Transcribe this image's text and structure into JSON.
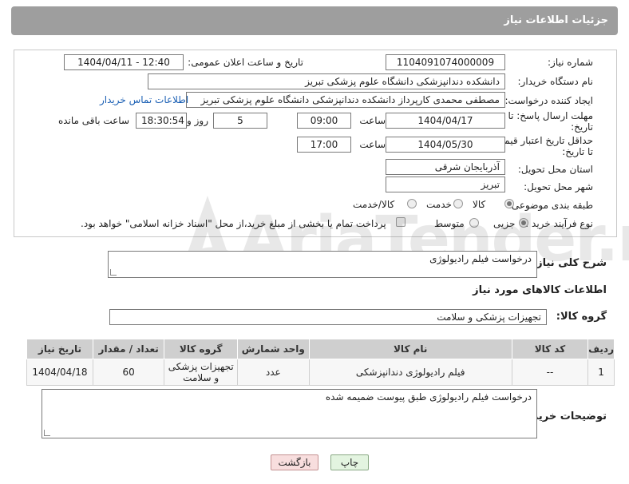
{
  "header": {
    "title": "جزئیات اطلاعات نیاز"
  },
  "form": {
    "need_number_label": "شماره نیاز:",
    "need_number": "1104091074000009",
    "announce_label": "تاریخ و ساعت اعلان عمومی:",
    "announce_value": "1404/04/11 - 12:40",
    "buyer_org_label": "نام دستگاه خریدار:",
    "buyer_org": "دانشکده دندانپزشکی دانشگاه علوم پزشکی تبریز",
    "creator_label": "ایجاد کننده درخواست:",
    "creator": "مصطفی محمدی کارپرداز دانشکده دندانپزشکی دانشگاه علوم پزشکی تبریز",
    "contact_link": "اطلاعات تماس خریدار",
    "deadline_label_1": "مهلت ارسال پاسخ: تا",
    "deadline_label_2": "تاریخ:",
    "deadline_date": "1404/04/17",
    "time_label": "ساعت",
    "deadline_time": "09:00",
    "days_value": "5",
    "days_label": "روز و",
    "remaining_time": "18:30:54",
    "remaining_label": "ساعت باقی مانده",
    "price_valid_label_1": "حداقل تاریخ اعتبار قیمت:",
    "price_valid_label_2": "تا تاریخ:",
    "price_valid_date": "1404/05/30",
    "price_valid_time": "17:00",
    "province_label": "استان محل تحویل:",
    "province": "آذربایجان شرقی",
    "city_label": "شهر محل تحویل:",
    "city": "تبریز",
    "category_label": "طبقه بندی موضوعی:",
    "category_options": [
      "کالا",
      "خدمت",
      "کالا/خدمت"
    ],
    "process_label": "نوع فرآیند خرید :",
    "process_options": [
      "جزیی",
      "متوسط"
    ],
    "payment_note": "پرداخت تمام یا بخشی از مبلغ خرید،از محل \"اسناد خزانه اسلامی\" خواهد بود."
  },
  "summary": {
    "label": "شرح کلی نیاز:",
    "value": "درخواست فیلم رادیولوژی"
  },
  "goods": {
    "section_title": "اطلاعات کالاهای مورد نیاز",
    "group_label": "گروه کالا:",
    "group_value": "تجهیزات پزشکی و سلامت"
  },
  "table": {
    "headers": [
      "ردیف",
      "کد کالا",
      "نام کالا",
      "واحد شمارش",
      "گروه کالا",
      "تعداد / مقدار",
      "تاریخ نیاز"
    ],
    "rows": [
      [
        "1",
        "--",
        "فیلم رادیولوژی دندانپزشکی",
        "عدد",
        "تجهیزات پزشکی و سلامت",
        "60",
        "1404/04/18"
      ]
    ]
  },
  "buyer_notes": {
    "label": "توضیحات خریدار:",
    "value": "درخواست فیلم رادیولوژی طبق پیوست ضمیمه شده"
  },
  "buttons": {
    "print": "چاپ",
    "back": "بازگشت"
  },
  "watermark": {
    "text": "AriaTender.neT"
  },
  "colors": {
    "header_bg": "#9e9e9e",
    "link": "#1a5fb4",
    "print_bg": "#e3f4e0",
    "back_bg": "#f8dede"
  }
}
